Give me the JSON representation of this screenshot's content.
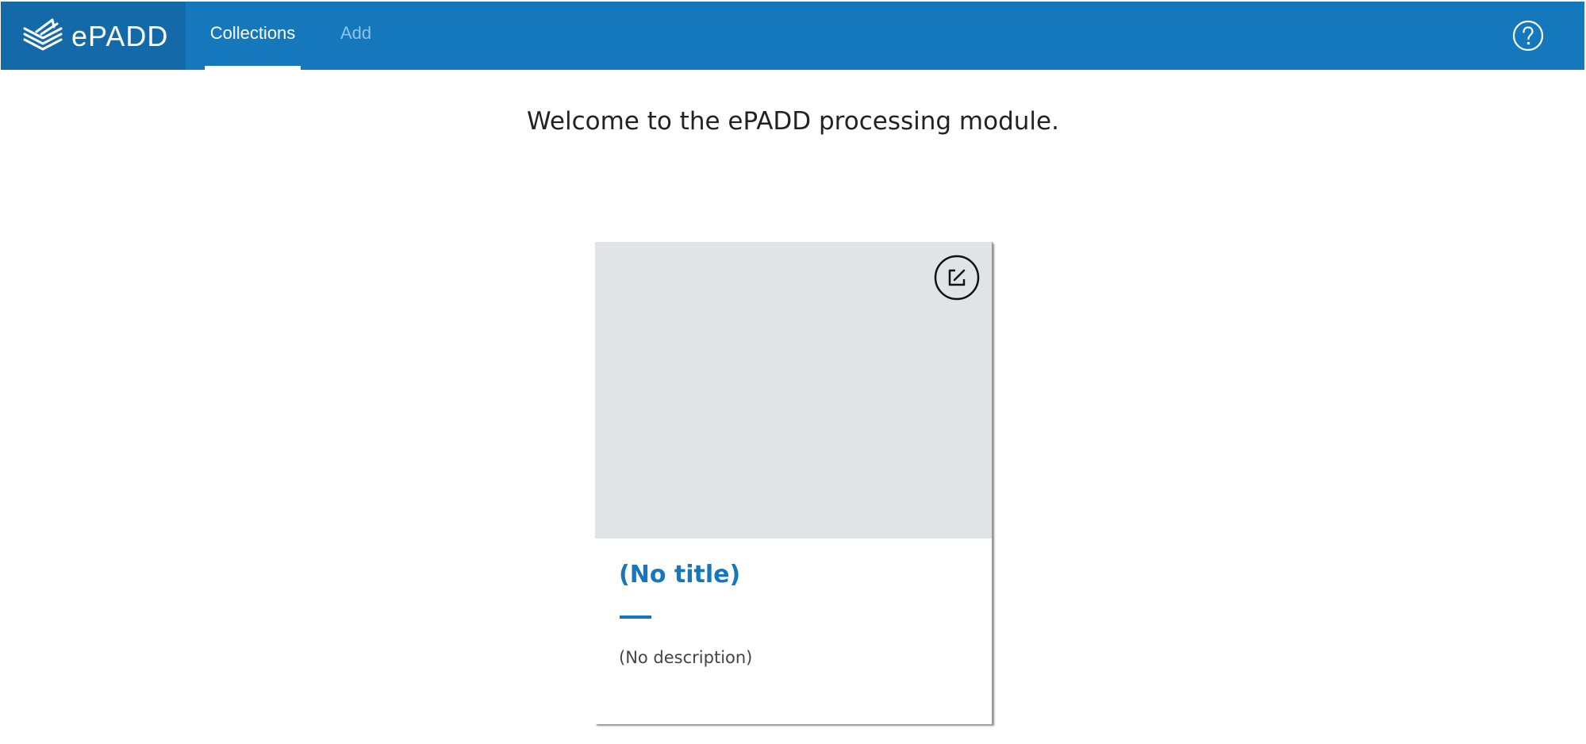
{
  "app": {
    "logo_text": "ePADD",
    "brand_color": "#1578bd",
    "brand_dark_color": "#146aa8",
    "logo_icon": "stacked-envelopes-icon",
    "help_icon": "question-circle-icon"
  },
  "nav": {
    "tabs": [
      {
        "label": "Collections",
        "active": true
      },
      {
        "label": "Add",
        "active": false
      }
    ]
  },
  "main": {
    "welcome": "Welcome to the ePADD processing module."
  },
  "collection_card": {
    "title": "(No title)",
    "description": "(No description)",
    "edit_icon": "edit-square-icon",
    "image_placeholder_color": "#e0e4e7"
  }
}
